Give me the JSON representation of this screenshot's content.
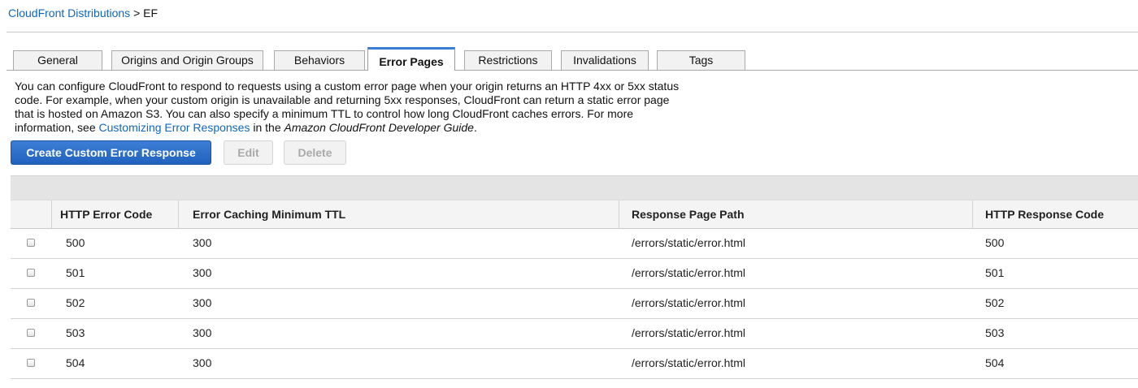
{
  "breadcrumb": {
    "link": "CloudFront Distributions",
    "separator": ">",
    "current": "EF"
  },
  "tabs": [
    {
      "label": "General",
      "active": false
    },
    {
      "label": "Origins and Origin Groups",
      "active": false
    },
    {
      "label": "Behaviors",
      "active": false
    },
    {
      "label": "Error Pages",
      "active": true
    },
    {
      "label": "Restrictions",
      "active": false
    },
    {
      "label": "Invalidations",
      "active": false
    },
    {
      "label": "Tags",
      "active": false
    }
  ],
  "description": {
    "text1": "You can configure CloudFront to respond to requests using a custom error page when your origin returns an HTTP 4xx or 5xx status code. For example, when your custom origin is unavailable and returning 5xx responses, CloudFront can return a static error page that is hosted on Amazon S3. You can also specify a minimum TTL to control how long CloudFront caches errors. For more information, see",
    "link": "Customizing Error Responses",
    "text2": "in the",
    "guide": "Amazon CloudFront Developer Guide",
    "text3": "."
  },
  "actions": {
    "create": "Create Custom Error Response",
    "edit": "Edit",
    "delete": "Delete"
  },
  "table": {
    "columns": [
      "HTTP Error Code",
      "Error Caching Minimum TTL",
      "Response Page Path",
      "HTTP Response Code"
    ],
    "rows": [
      {
        "code": "500",
        "ttl": "300",
        "path": "/errors/static/error.html",
        "response": "500"
      },
      {
        "code": "501",
        "ttl": "300",
        "path": "/errors/static/error.html",
        "response": "501"
      },
      {
        "code": "502",
        "ttl": "300",
        "path": "/errors/static/error.html",
        "response": "502"
      },
      {
        "code": "503",
        "ttl": "300",
        "path": "/errors/static/error.html",
        "response": "503"
      },
      {
        "code": "504",
        "ttl": "300",
        "path": "/errors/static/error.html",
        "response": "504"
      }
    ]
  },
  "colors": {
    "link": "#1166bb",
    "primary_button": "#2a6fcc",
    "active_tab_accent": "#3a7dd6"
  }
}
